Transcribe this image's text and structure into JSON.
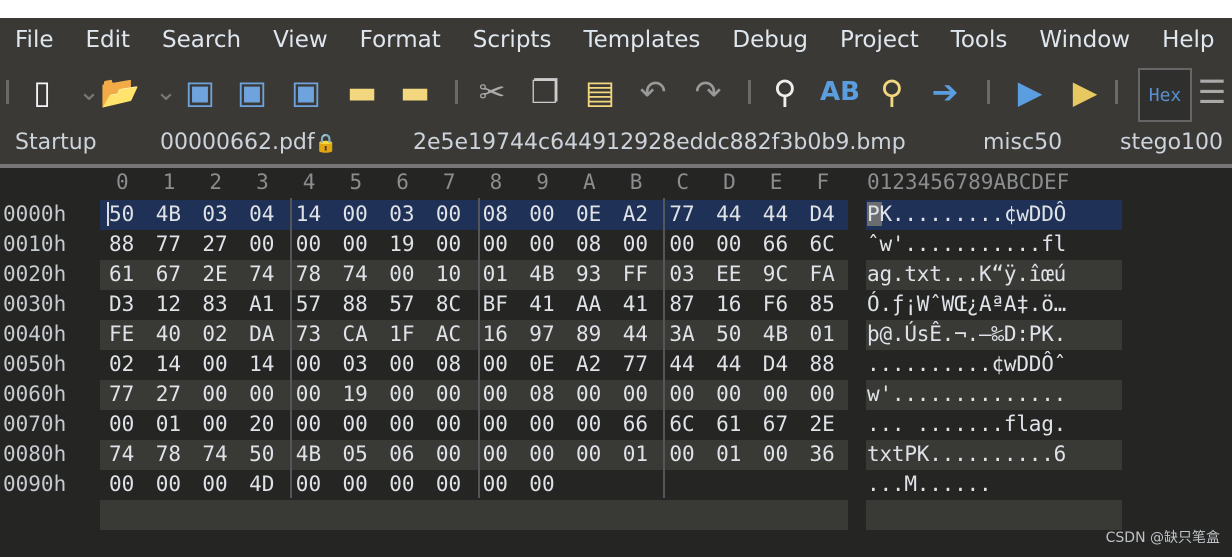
{
  "menu": [
    "File",
    "Edit",
    "Search",
    "View",
    "Format",
    "Scripts",
    "Templates",
    "Debug",
    "Project",
    "Tools",
    "Window",
    "Help"
  ],
  "toolbar": {
    "icons": [
      "new-file-icon",
      "dropdown-icon",
      "open-folder-icon",
      "dropdown-icon",
      "save-icon",
      "save-as-icon",
      "save-all-icon",
      "folder-icon",
      "open-multiple-icon",
      "cut-icon",
      "copy-icon",
      "paste-icon",
      "undo-icon",
      "redo-icon",
      "find-icon",
      "replace-icon",
      "find-in-files-icon",
      "goto-icon",
      "run-script-icon",
      "run-template-icon",
      "hex-mode-icon",
      "compare-icon"
    ],
    "hex_label": "Hex"
  },
  "tabs": [
    {
      "label": "Startup"
    },
    {
      "label": "00000662.pdf",
      "locked": true
    },
    {
      "label": "2e5e19744c644912928eddc882f3b0b9.bmp"
    },
    {
      "label": "misc50"
    },
    {
      "label": "stego100"
    }
  ],
  "hex": {
    "col_headers": [
      "0",
      "1",
      "2",
      "3",
      "4",
      "5",
      "6",
      "7",
      "8",
      "9",
      "A",
      "B",
      "C",
      "D",
      "E",
      "F"
    ],
    "text_header": "0123456789ABCDEF",
    "rows": [
      {
        "offset": "0000h",
        "bytes": [
          "50",
          "4B",
          "03",
          "04",
          "14",
          "00",
          "03",
          "00",
          "08",
          "00",
          "0E",
          "A2",
          "77",
          "44",
          "44",
          "D4"
        ],
        "text": "PK.........¢wDDÔ"
      },
      {
        "offset": "0010h",
        "bytes": [
          "88",
          "77",
          "27",
          "00",
          "00",
          "00",
          "19",
          "00",
          "00",
          "00",
          "08",
          "00",
          "00",
          "00",
          "66",
          "6C"
        ],
        "text": "ˆw'...........fl"
      },
      {
        "offset": "0020h",
        "bytes": [
          "61",
          "67",
          "2E",
          "74",
          "78",
          "74",
          "00",
          "10",
          "01",
          "4B",
          "93",
          "FF",
          "03",
          "EE",
          "9C",
          "FA"
        ],
        "text": "ag.txt...K“ÿ.îœú"
      },
      {
        "offset": "0030h",
        "bytes": [
          "D3",
          "12",
          "83",
          "A1",
          "57",
          "88",
          "57",
          "8C",
          "BF",
          "41",
          "AA",
          "41",
          "87",
          "16",
          "F6",
          "85"
        ],
        "text": "Ó.ƒ¡WˆWŒ¿AªA‡.ö…"
      },
      {
        "offset": "0040h",
        "bytes": [
          "FE",
          "40",
          "02",
          "DA",
          "73",
          "CA",
          "1F",
          "AC",
          "16",
          "97",
          "89",
          "44",
          "3A",
          "50",
          "4B",
          "01"
        ],
        "text": "þ@.ÚsÊ.¬.—‰D:PK."
      },
      {
        "offset": "0050h",
        "bytes": [
          "02",
          "14",
          "00",
          "14",
          "00",
          "03",
          "00",
          "08",
          "00",
          "0E",
          "A2",
          "77",
          "44",
          "44",
          "D4",
          "88"
        ],
        "text": "..........¢wDDÔˆ"
      },
      {
        "offset": "0060h",
        "bytes": [
          "77",
          "27",
          "00",
          "00",
          "00",
          "19",
          "00",
          "00",
          "00",
          "08",
          "00",
          "00",
          "00",
          "00",
          "00",
          "00"
        ],
        "text": "w'.............."
      },
      {
        "offset": "0070h",
        "bytes": [
          "00",
          "01",
          "00",
          "20",
          "00",
          "00",
          "00",
          "00",
          "00",
          "00",
          "00",
          "66",
          "6C",
          "61",
          "67",
          "2E"
        ],
        "text": "... .......flag."
      },
      {
        "offset": "0080h",
        "bytes": [
          "74",
          "78",
          "74",
          "50",
          "4B",
          "05",
          "06",
          "00",
          "00",
          "00",
          "00",
          "01",
          "00",
          "01",
          "00",
          "36"
        ],
        "text": "txtPK..........6"
      },
      {
        "offset": "0090h",
        "bytes": [
          "00",
          "00",
          "00",
          "4D",
          "00",
          "00",
          "00",
          "00",
          "00",
          "00"
        ],
        "text": "...M......"
      }
    ]
  },
  "colors": {
    "selection": "#1f3156",
    "stripe": "#393936",
    "background": "#252523"
  },
  "watermark": "CSDN @缺只笔盒"
}
